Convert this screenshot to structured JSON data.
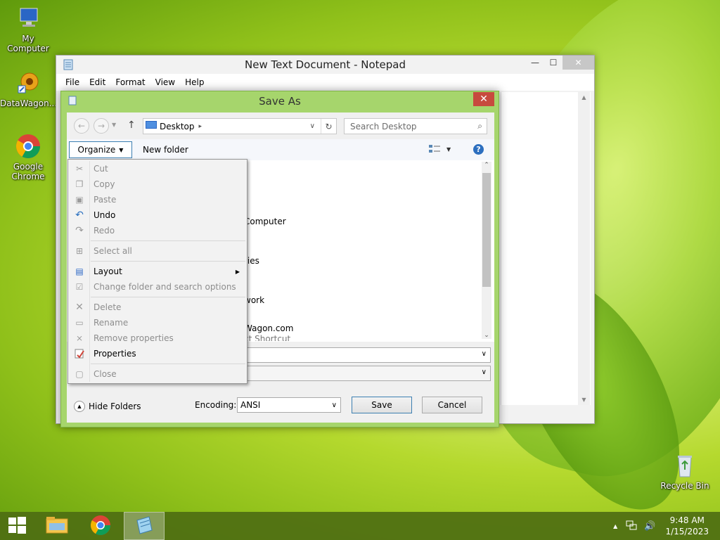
{
  "desktop": {
    "icons": [
      {
        "label": "My Computer"
      },
      {
        "label": "DataWagon...."
      },
      {
        "label": "Google Chrome"
      },
      {
        "label": "Recycle Bin"
      }
    ]
  },
  "notepad": {
    "title": "New Text Document - Notepad",
    "menu": [
      "File",
      "Edit",
      "Format",
      "View",
      "Help"
    ],
    "caption": {
      "minimize": "—",
      "maximize": "☐",
      "close": "✕"
    }
  },
  "save_as": {
    "title": "Save As",
    "close": "✕",
    "address": "Desktop",
    "search_placeholder": "Search Desktop",
    "organize_label": "Organize",
    "new_folder_label": "New folder",
    "partial_items": [
      "Computer",
      "ries",
      "work",
      "Wagon.com",
      "ct Shortcut"
    ],
    "hide_folders": "Hide Folders",
    "encoding_label": "Encoding:",
    "encoding_value": "ANSI",
    "save_label": "Save",
    "cancel_label": "Cancel"
  },
  "organize_menu": {
    "items": [
      {
        "label": "Cut",
        "enabled": false
      },
      {
        "label": "Copy",
        "enabled": false
      },
      {
        "label": "Paste",
        "enabled": false
      },
      {
        "label": "Undo",
        "enabled": true
      },
      {
        "label": "Redo",
        "enabled": false
      },
      {
        "label": "Select all",
        "enabled": false
      },
      {
        "label": "Layout",
        "enabled": true
      },
      {
        "label": "Change folder and search options",
        "enabled": false
      },
      {
        "label": "Delete",
        "enabled": false
      },
      {
        "label": "Rename",
        "enabled": false
      },
      {
        "label": "Remove properties",
        "enabled": false
      },
      {
        "label": "Properties",
        "enabled": true
      },
      {
        "label": "Close",
        "enabled": false
      }
    ]
  },
  "taskbar": {
    "time": "9:48 AM",
    "date": "1/15/2023"
  },
  "colors": {
    "dialog_frame": "#a6d56c",
    "close_red": "#c74a3e",
    "taskbar": "#4e6e12",
    "accent_blue": "#3c7fb1"
  }
}
